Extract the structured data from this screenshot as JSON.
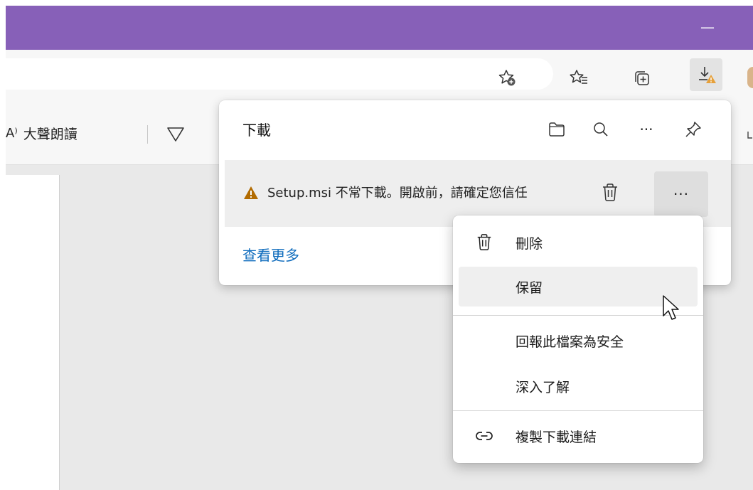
{
  "titlebar": {
    "minimize_glyph": "—",
    "color": "#8760b8"
  },
  "address_bar": {
    "icons": [
      "add-favorite-icon",
      "favorites-icon",
      "collections-icon",
      "downloads-warning-icon"
    ]
  },
  "reader_toolbar": {
    "aa_glyph": "A⁾",
    "read_aloud_label": "大聲朗讀"
  },
  "downloads": {
    "title": "下載",
    "header_icons": [
      "folder-icon",
      "search-icon",
      "more-icon",
      "pin-icon"
    ],
    "more_glyph": "···",
    "item": {
      "warning_color": "#b26b00",
      "text": "Setup.msi 不常下載。開啟前，請確定您信任",
      "more_glyph": "···"
    },
    "see_more": "查看更多",
    "link_color": "#0f6cbd"
  },
  "context_menu": {
    "items": [
      {
        "label": "刪除",
        "icon": "trash-icon"
      },
      {
        "label": "保留",
        "icon": ""
      },
      {
        "label": "回報此檔案為安全",
        "icon": ""
      },
      {
        "label": "深入了解",
        "icon": ""
      },
      {
        "label": "複製下載連結",
        "icon": "link-icon"
      }
    ]
  }
}
